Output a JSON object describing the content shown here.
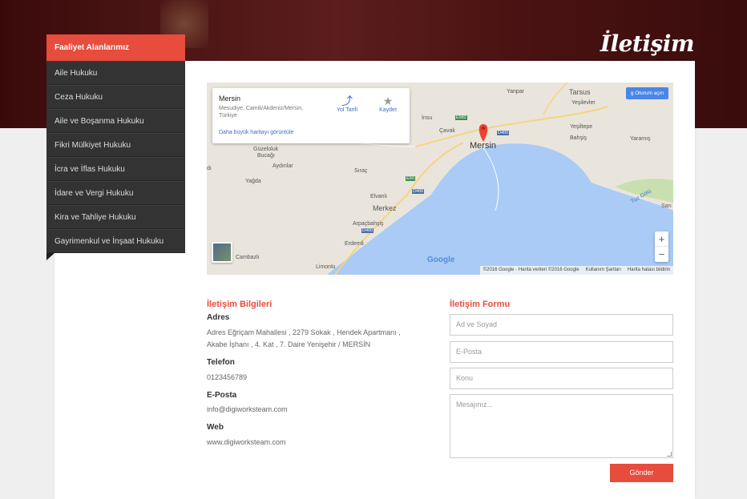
{
  "header": {
    "page_title": "İletişim"
  },
  "sidebar": {
    "header": "Faaliyet Alanlarımız",
    "items": [
      {
        "label": "Aile Hukuku"
      },
      {
        "label": "Ceza Hukuku"
      },
      {
        "label": "Aile ve Boşanma Hukuku"
      },
      {
        "label": "Fikri Mülkiyet Hukuku"
      },
      {
        "label": "İcra ve İflas Hukuku"
      },
      {
        "label": "İdare ve Vergi Hukuku"
      },
      {
        "label": "Kira ve Tahliye Hukuku"
      },
      {
        "label": "Gayrimenkul ve İnşaat Hukuku"
      }
    ]
  },
  "map": {
    "info": {
      "title": "Mersin",
      "address": "Mesudiye, Camili/Akdeniz/Mersin, Türkiye",
      "larger_map_link": "Daha büyük haritayı görüntüle",
      "directions_label": "Yol Tarifi",
      "save_label": "Kaydet"
    },
    "signin_label": "Oturum açın",
    "labels": {
      "mersin": "Mersin",
      "tarsus": "Tarsus",
      "yanpar": "Yanpar",
      "yesilevler": "Yeşilevler",
      "yesiltepe": "Yeşiltepe",
      "bahsis": "Bahşiş",
      "yaramis": "Yaramış",
      "cavak": "Çavak",
      "insu": "İnsu",
      "guzeloluk": "Güzeloluk",
      "bucagi": "Bucağı",
      "aydinlar": "Aydınlar",
      "sirac": "Sıraç",
      "yagda": "Yağda",
      "elvanli": "Elvanlı",
      "merkez": "Merkez",
      "arpacbahsis": "Arpaçbahşiş",
      "erdemli": "Erdemli",
      "cambazli": "Cambazlı",
      "limonlu": "Limonlu",
      "tuz_golu": "Tuz Gölü",
      "sari": "Sarı",
      "d400": "D400",
      "e90": "E90",
      "e982": "E982",
      "edge_left": "dı"
    },
    "google_logo": "Google",
    "footer": {
      "copyright": "©2016 Google · Harita verileri ©2016 Google",
      "terms": "Kullanım Şartları",
      "report": "Harita hatası bildirin"
    }
  },
  "contact_info": {
    "title": "İletişim Bilgileri",
    "address_label": "Adres",
    "address_line1": "Adres Eğriçam Mahallesi , 2279 Sokak , Hendek Apartmanı ,",
    "address_line2": "Akabe İşhanı , 4. Kat , 7. Daire Yenişehir / MERSİN",
    "phone_label": "Telefon",
    "phone": "0123456789",
    "email_label": "E-Posta",
    "email": "info@digiworksteam.com",
    "web_label": "Web",
    "web": "www.digiworksteam.com"
  },
  "contact_form": {
    "title": "İletişim Formu",
    "name_placeholder": "Ad ve Soyad",
    "email_placeholder": "E-Posta",
    "subject_placeholder": "Konu",
    "message_placeholder": "Mesajınız...",
    "submit_label": "Gönder"
  }
}
